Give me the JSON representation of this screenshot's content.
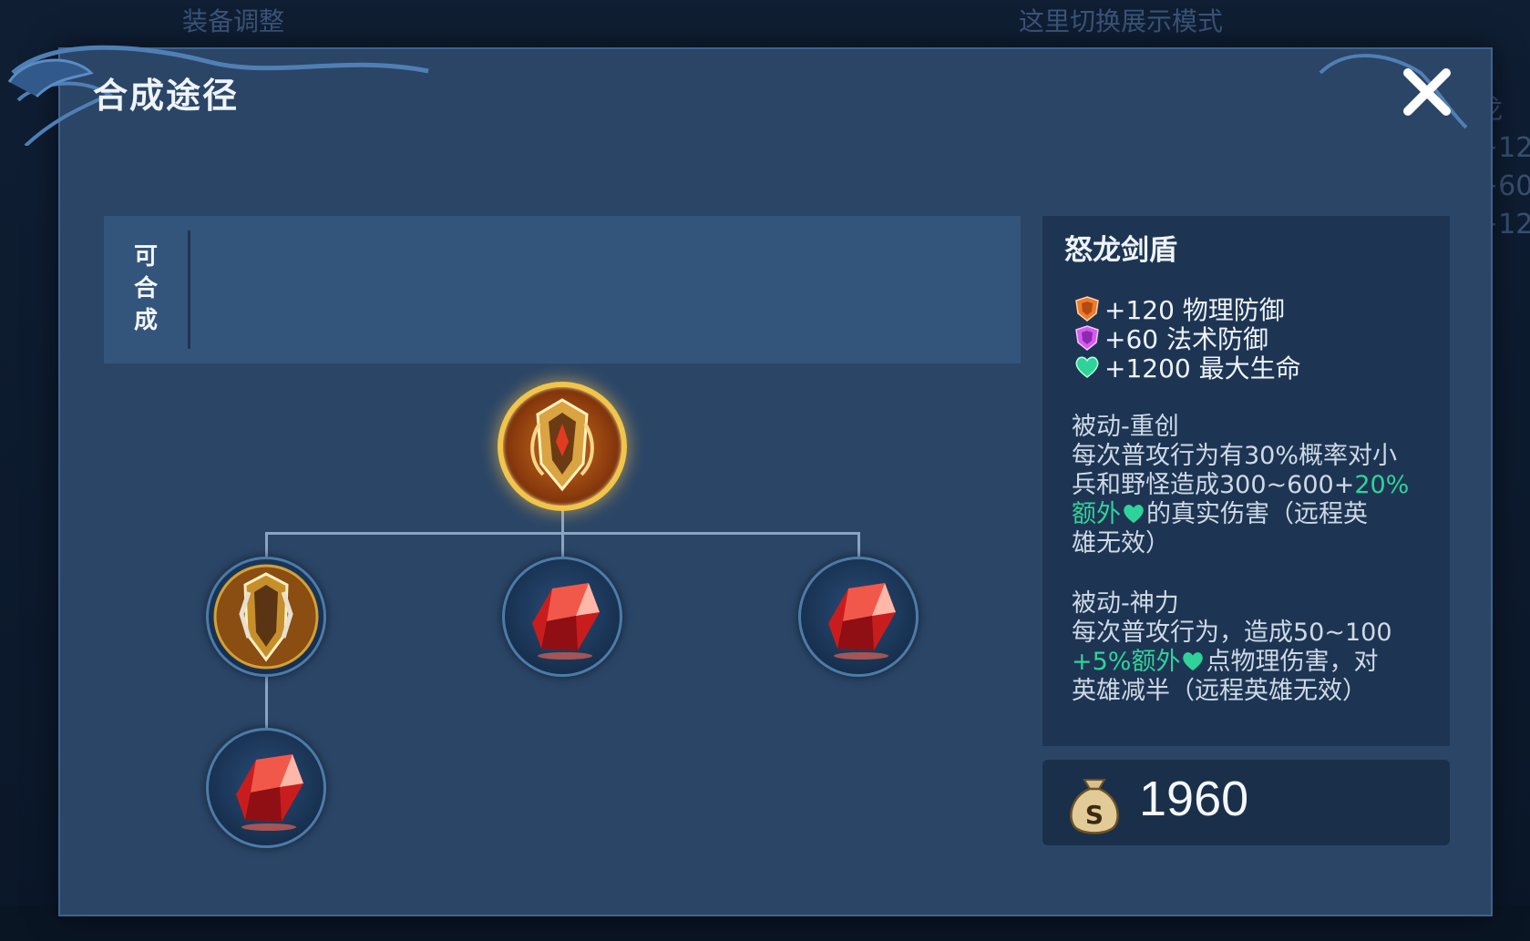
{
  "background": {
    "top_items": [
      "装备调整",
      "这里切换展示模式"
    ],
    "right_text": [
      "龙",
      "+12",
      "+60",
      "+12"
    ]
  },
  "dialog": {
    "title": "合成途径",
    "close_label": "✕"
  },
  "craftable": {
    "label_chars": [
      "可",
      "合",
      "成"
    ]
  },
  "tree": {
    "root": {
      "item": "怒龙剑盾",
      "icon": "dragon-sword-shield-icon"
    },
    "children": [
      {
        "icon": "shield-icon"
      },
      {
        "icon": "red-crystal-icon"
      },
      {
        "icon": "red-crystal-icon"
      }
    ],
    "grandchildren": [
      {
        "icon": "red-crystal-icon"
      }
    ]
  },
  "item": {
    "name": "怒龙剑盾",
    "stats": [
      {
        "icon": "physical-defense-icon",
        "text": "+120 物理防御",
        "color": "#f07a2b"
      },
      {
        "icon": "magic-defense-icon",
        "text": "+60 法术防御",
        "color": "#d45cf0"
      },
      {
        "icon": "health-icon",
        "text": "+1200 最大生命",
        "color": "#2fd39a"
      }
    ],
    "passive1": {
      "title": "被动-重创",
      "line1": "每次普攻行为有30%概率对小",
      "line2a": "兵和野怪造成300~600+",
      "line2b": "20%",
      "line3a": "额外",
      "line3b": "的真实伤害（远程英",
      "line4": "雄无效）"
    },
    "passive2": {
      "title": "被动-神力",
      "line1": "每次普攻行为，造成50~100",
      "line2a": "+5%额外",
      "line2b": "点物理伤害，对",
      "line3": "英雄减半（远程英雄无效）"
    },
    "highlight_color": "#2fd39a"
  },
  "price": {
    "value": "1960",
    "icon": "gold-bag-icon"
  }
}
